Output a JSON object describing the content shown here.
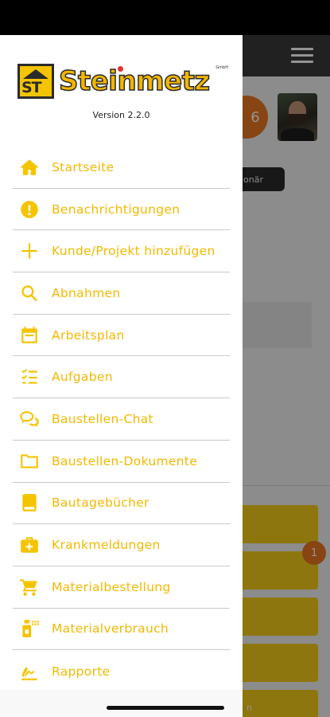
{
  "background": {
    "badge_count": "6",
    "pill_text": "onär",
    "notif_count": "1",
    "tile_text": "n"
  },
  "drawer": {
    "logo": {
      "brand": "Steinmetz",
      "suffix": "GmbH",
      "mark": "ST"
    },
    "version": "Version 2.2.0",
    "menu": [
      {
        "label": "Startseite",
        "icon": "home-icon"
      },
      {
        "label": "Benachrichtigungen",
        "icon": "alert-circle-icon"
      },
      {
        "label": "Kunde/Projekt hinzufügen",
        "icon": "plus-icon"
      },
      {
        "label": "Abnahmen",
        "icon": "search-icon"
      },
      {
        "label": "Arbeitsplan",
        "icon": "calendar-icon"
      },
      {
        "label": "Aufgaben",
        "icon": "checklist-icon"
      },
      {
        "label": "Baustellen-Chat",
        "icon": "chat-icon"
      },
      {
        "label": "Baustellen-Dokumente",
        "icon": "folder-icon"
      },
      {
        "label": "Bautagebücher",
        "icon": "book-icon"
      },
      {
        "label": "Krankmeldungen",
        "icon": "medical-kit-icon"
      },
      {
        "label": "Materialbestellung",
        "icon": "cart-icon"
      },
      {
        "label": "Materialverbrauch",
        "icon": "spray-can-icon"
      },
      {
        "label": "Rapporte",
        "icon": "signature-icon"
      }
    ]
  },
  "colors": {
    "accent": "#f5c400",
    "menu_text": "#f2b900",
    "badge": "#e87722"
  }
}
